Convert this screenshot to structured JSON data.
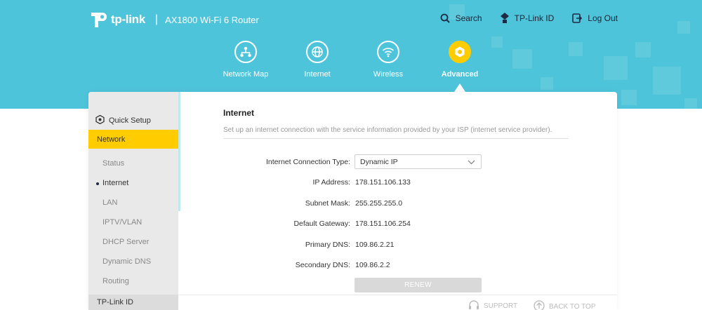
{
  "header": {
    "logo_text": "tp-link",
    "separator": "|",
    "model": "AX1800 Wi-Fi 6 Router",
    "links": [
      {
        "label": "Search",
        "icon": "search-icon"
      },
      {
        "label": "TP-Link ID",
        "icon": "tplink-id-icon"
      },
      {
        "label": "Log Out",
        "icon": "logout-icon"
      }
    ],
    "nav": [
      {
        "label": "Network Map",
        "icon": "network-map-icon"
      },
      {
        "label": "Internet",
        "icon": "globe-icon"
      },
      {
        "label": "Wireless",
        "icon": "wifi-icon"
      },
      {
        "label": "Advanced",
        "icon": "gear-icon",
        "active": true
      }
    ]
  },
  "sidebar": {
    "quick_setup": "Quick Setup",
    "network": "Network",
    "items": [
      {
        "label": "Status"
      },
      {
        "label": "Internet",
        "active": true
      },
      {
        "label": "LAN"
      },
      {
        "label": "IPTV/VLAN"
      },
      {
        "label": "DHCP Server"
      },
      {
        "label": "Dynamic DNS"
      },
      {
        "label": "Routing"
      }
    ],
    "bottom": "TP-Link ID"
  },
  "content": {
    "title": "Internet",
    "description": "Set up an internet connection with the service information provided by your ISP (internet service provider).",
    "connection_type_label": "Internet Connection Type:",
    "connection_type_value": "Dynamic IP",
    "fields": [
      {
        "label": "IP Address:",
        "value": "178.151.106.133"
      },
      {
        "label": "Subnet Mask:",
        "value": "255.255.255.0"
      },
      {
        "label": "Default Gateway:",
        "value": "178.151.106.254"
      },
      {
        "label": "Primary DNS:",
        "value": "109.86.2.21"
      },
      {
        "label": "Secondary DNS:",
        "value": "109.86.2.2"
      }
    ],
    "renew_label": "RENEW"
  },
  "footer": {
    "support": "SUPPORT",
    "back_to_top": "BACK TO TOP"
  },
  "colors": {
    "header_bg": "#4ec4da",
    "accent": "#ffcc00",
    "sidebar_bg": "#e9e9e9"
  }
}
